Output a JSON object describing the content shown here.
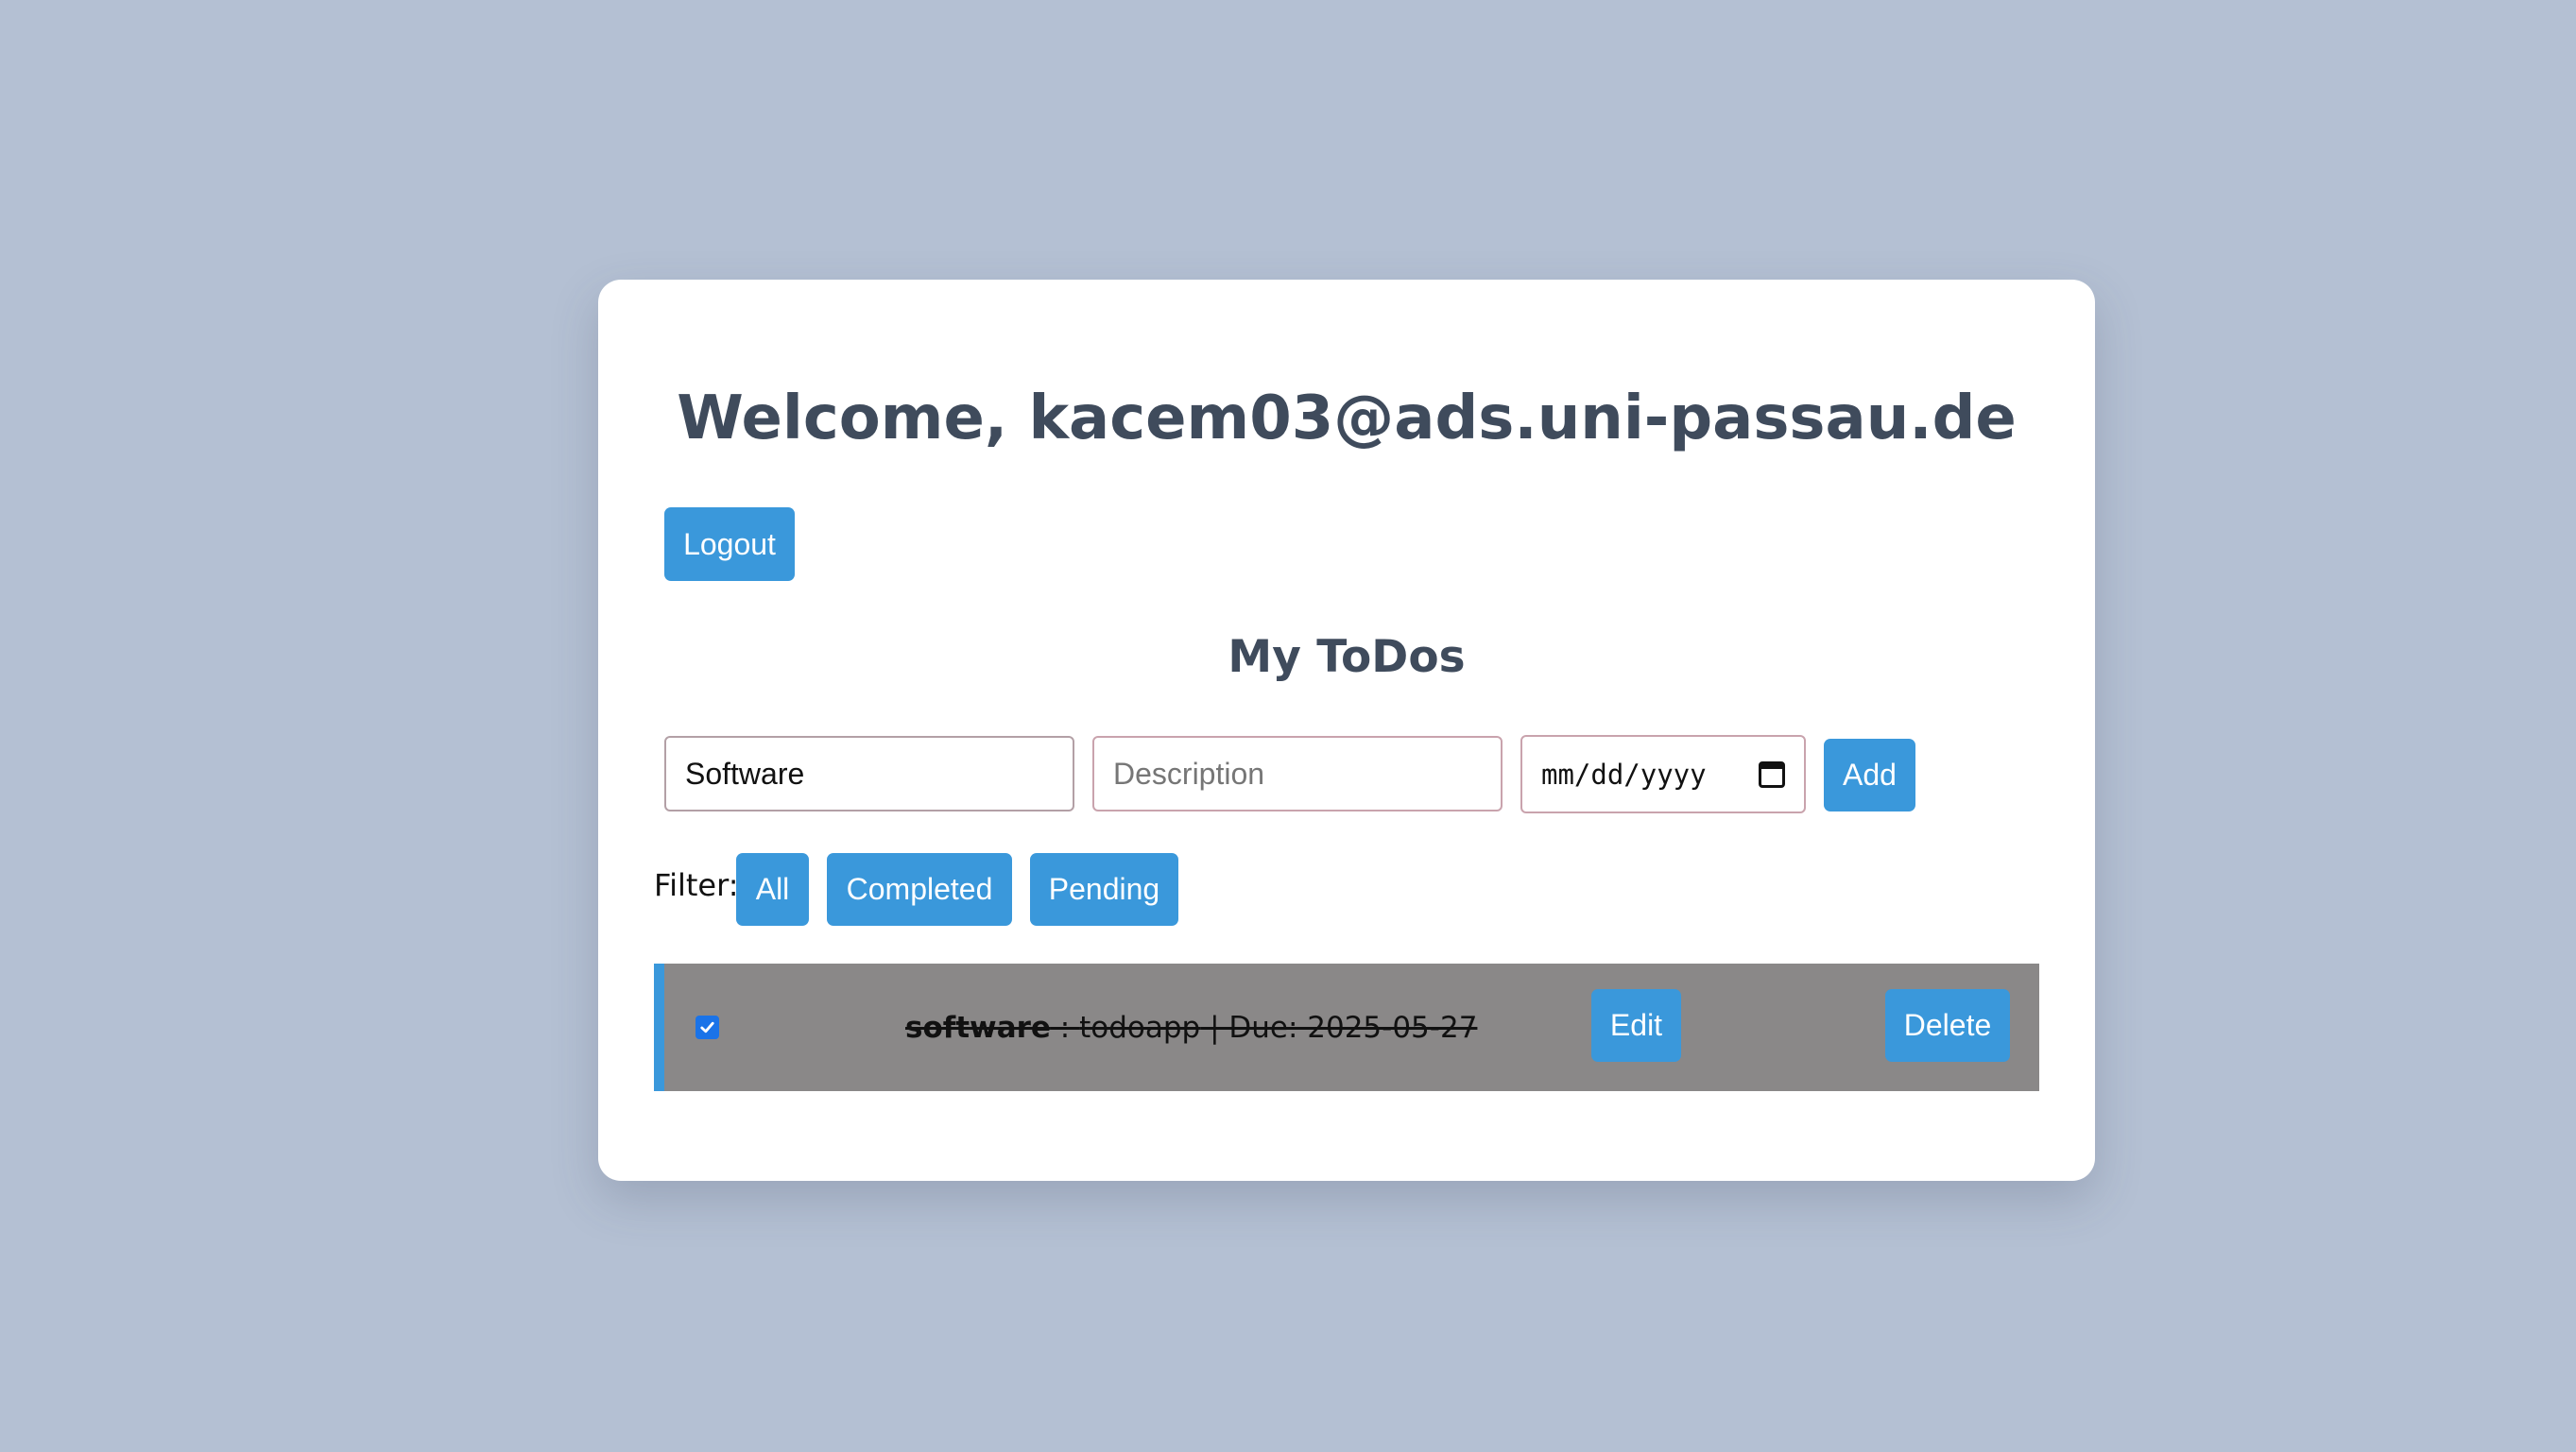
{
  "header": {
    "title": "Welcome, kacem03@ads.uni-passau.de",
    "logout_label": "Logout"
  },
  "todos_section": {
    "heading": "My ToDos"
  },
  "new_todo_form": {
    "title_value": "Software",
    "description_placeholder": "Description",
    "date_placeholder": "mm/dd/yyyy",
    "add_label": "Add"
  },
  "filter": {
    "label": "Filter:",
    "options": [
      "All",
      "Completed",
      "Pending"
    ]
  },
  "todos": [
    {
      "title": "software",
      "separator": " : ",
      "description": "todoapp",
      "due_text": " | Due: 2025-05-27",
      "completed": true,
      "edit_label": "Edit",
      "delete_label": "Delete"
    }
  ],
  "colors": {
    "background": "#b4c0d3",
    "accent": "#3a98db",
    "heading": "#3f4b5c",
    "completed_row": "#8a8888"
  }
}
